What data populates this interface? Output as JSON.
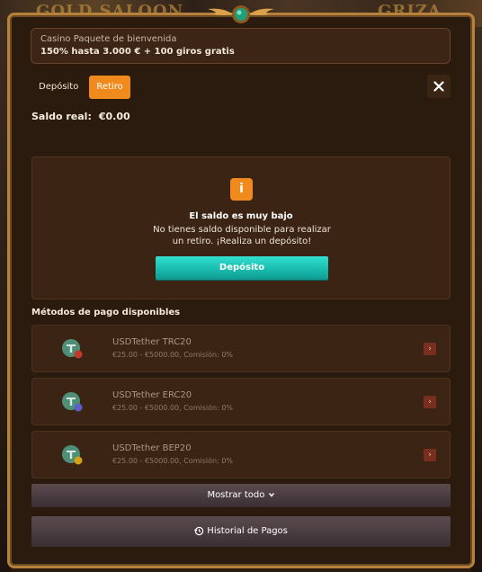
{
  "background": {
    "left_text": "GOLD SALOON",
    "right_text": "GRIZA"
  },
  "promo": {
    "title": "Casino Paquete de bienvenida",
    "offer": "150% hasta 3.000 € + 100 giros gratis"
  },
  "tabs": [
    {
      "label": "Depósito",
      "active": false
    },
    {
      "label": "Retiro",
      "active": true
    }
  ],
  "balance": {
    "label": "Saldo real:",
    "value": "€0.00"
  },
  "notice": {
    "icon": "info-icon",
    "title": "El saldo es muy bajo",
    "text": "No tienes saldo disponible para realizar un retiro. ¡Realiza un depósito!",
    "button_label": "Depósito"
  },
  "methods": {
    "title": "Métodos de pago disponibles",
    "items": [
      {
        "name": "USDTether TRC20",
        "details": "€25.00 - €5000.00, Comisión: 0%",
        "badge_color": "#c0392b"
      },
      {
        "name": "USDTether ERC20",
        "details": "€25.00 - €5000.00, Comisión: 0%",
        "badge_color": "#5b5fc7"
      },
      {
        "name": "USDTether BEP20",
        "details": "€25.00 - €5000.00, Comisión: 0%",
        "badge_color": "#d4a017"
      }
    ]
  },
  "show_all_label": "Mostrar todo",
  "history_label": "Historial de Pagos",
  "colors": {
    "accent_orange": "#f08a1c",
    "accent_teal": "#1bbfb2",
    "frame_gold": "#b6813a",
    "panel_brown": "#3b2414"
  }
}
